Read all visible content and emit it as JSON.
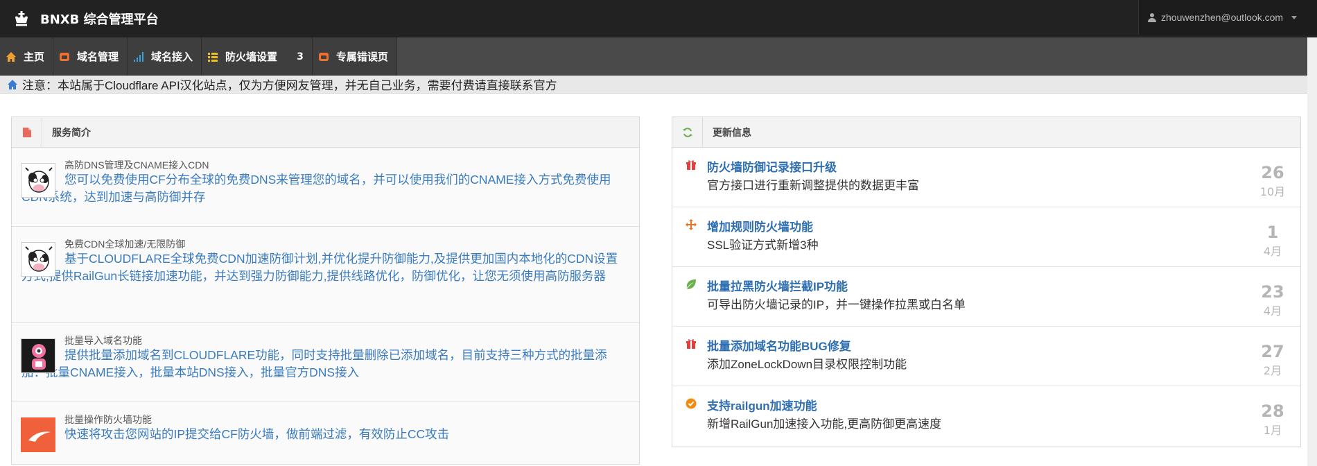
{
  "header": {
    "title": "BNXB 综合管理平台",
    "user_email": "zhouwenzhen@outlook.com"
  },
  "nav": {
    "items": [
      {
        "label": "主页",
        "icon": "home-icon",
        "color": "#f0a030"
      },
      {
        "label": "域名管理",
        "icon": "box-icon",
        "color": "#f07030"
      },
      {
        "label": "域名接入",
        "icon": "signal-icon",
        "color": "#3aa0e0"
      },
      {
        "label": "防火墙设置",
        "icon": "list-icon",
        "color": "#f0c020",
        "badge": "3"
      },
      {
        "label": "专属错误页",
        "icon": "box-icon",
        "color": "#f07030"
      }
    ]
  },
  "notice": {
    "text": "注意：本站属于Cloudflare API汉化站点，仅为方便网友管理，并无自己业务，需要付费请直接联系官方"
  },
  "services": {
    "title": "服务简介",
    "items": [
      {
        "title": "高防DNS管理及CNAME接入CDN",
        "desc": "您可以免费使用CF分布全球的免费DNS来管理您的域名，并可以使用我们的CNAME接入方式免费使用CDN系统，达到加速与高防御并存"
      },
      {
        "title": "免费CDN全球加速/无限防御",
        "desc": "基于CLOUDFLARE全球免费CDN加速防御计划,并优化提升防御能力,及提供更加国内本地化的CDN设置方式,提供RailGun长链接加速功能，并达到强力防御能力,提供线路优化，防御优化，让您无须使用高防服务器"
      },
      {
        "title": "批量导入域名功能",
        "desc": "提供批量添加域名到CLOUDFLARE功能，同时支持批量删除已添加域名，目前支持三种方式的批量添加：批量CNAME接入，批量本站DNS接入，批量官方DNS接入"
      },
      {
        "title": "批量操作防火墙功能",
        "desc": "快速将攻击您网站的IP提交给CF防火墙，做前端过滤，有效防止CC攻击"
      }
    ]
  },
  "updates": {
    "title": "更新信息",
    "items": [
      {
        "title": "防火墙防御记录接口升级",
        "desc": "官方接口进行重新调整提供的数据更丰富",
        "day": "26",
        "month": "10月",
        "icon": "gift-icon",
        "color": "#e04040"
      },
      {
        "title": "增加规则防火墙功能",
        "desc": "SSL验证方式新增3种",
        "day": "1",
        "month": "4月",
        "icon": "move-icon",
        "color": "#f07020"
      },
      {
        "title": "批量拉黑防火墙拦截IP功能",
        "desc": "可导出防火墙记录的IP，并一键操作拉黑或白名单",
        "day": "23",
        "month": "4月",
        "icon": "leaf-icon",
        "color": "#6ab04c"
      },
      {
        "title": "批量添加域名功能BUG修复",
        "desc": "添加ZoneLockDown目录权限控制功能",
        "day": "27",
        "month": "2月",
        "icon": "gift-icon",
        "color": "#e04040"
      },
      {
        "title": "支持railgun加速功能",
        "desc": "新增RailGun加速接入功能,更高防御更高速度",
        "day": "28",
        "month": "1月",
        "icon": "check-circle-icon",
        "color": "#f08c10"
      }
    ]
  }
}
